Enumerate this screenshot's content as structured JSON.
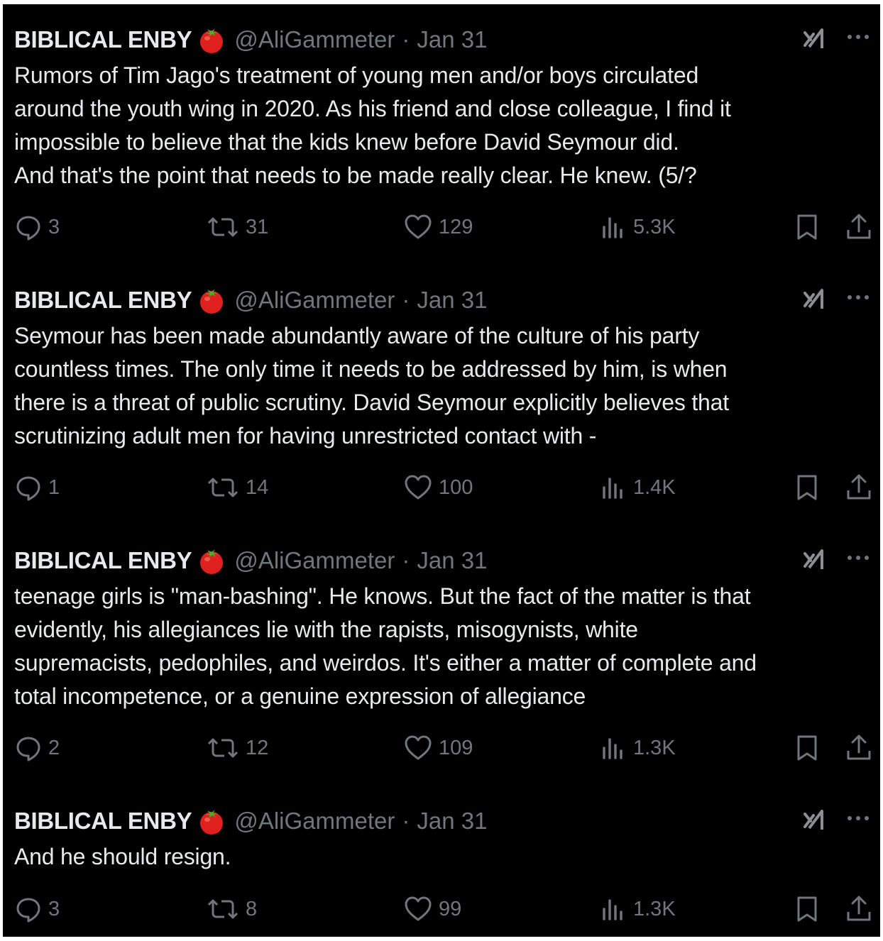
{
  "tweets": [
    {
      "display_name": "BIBLICAL ENBY",
      "handle": "@AliGammeter",
      "separator": "·",
      "date": "Jan 31",
      "text": "Rumors of Tim Jago's treatment of young men and/or boys circulated\naround the youth wing in 2020. As his friend and close colleague, I find it\nimpossible to believe that the kids knew before David Seymour did.\nAnd that's the point that needs to be made really clear. He knew. (5/?",
      "replies": "3",
      "reposts": "31",
      "likes": "129",
      "views": "5.3K"
    },
    {
      "display_name": "BIBLICAL ENBY",
      "handle": "@AliGammeter",
      "separator": "·",
      "date": "Jan 31",
      "text": "Seymour has been made abundantly aware of the culture of his party\ncountless times. The only time it needs to be addressed by him, is when\nthere is a threat of public scrutiny. David Seymour explicitly believes that\nscrutinizing adult men for having unrestricted contact with -",
      "replies": "1",
      "reposts": "14",
      "likes": "100",
      "views": "1.4K"
    },
    {
      "display_name": "BIBLICAL ENBY",
      "handle": "@AliGammeter",
      "separator": "·",
      "date": "Jan 31",
      "text": "teenage girls is \"man-bashing\". He knows. But the fact of the matter is that\nevidently, his allegiances lie with the rapists, misogynists, white\nsupremacists, pedophiles, and weirdos. It's either a matter of complete and\ntotal incompetence, or a genuine expression of allegiance",
      "replies": "2",
      "reposts": "12",
      "likes": "109",
      "views": "1.3K"
    },
    {
      "display_name": "BIBLICAL ENBY",
      "handle": "@AliGammeter",
      "separator": "·",
      "date": "Jan 31",
      "text": "And he should resign.",
      "replies": "3",
      "reposts": "8",
      "likes": "99",
      "views": "1.3K"
    }
  ],
  "icons": {
    "name_emoji": "tomato-icon",
    "grok": "grok-icon",
    "more": "more-icon",
    "reply": "reply-icon",
    "repost": "repost-icon",
    "like": "like-icon",
    "views": "views-icon",
    "bookmark": "bookmark-icon",
    "share": "share-icon"
  },
  "colors": {
    "background": "#000000",
    "primary_text": "#e7e9ea",
    "secondary_text": "#71767b",
    "tomato": "#e0201f"
  }
}
